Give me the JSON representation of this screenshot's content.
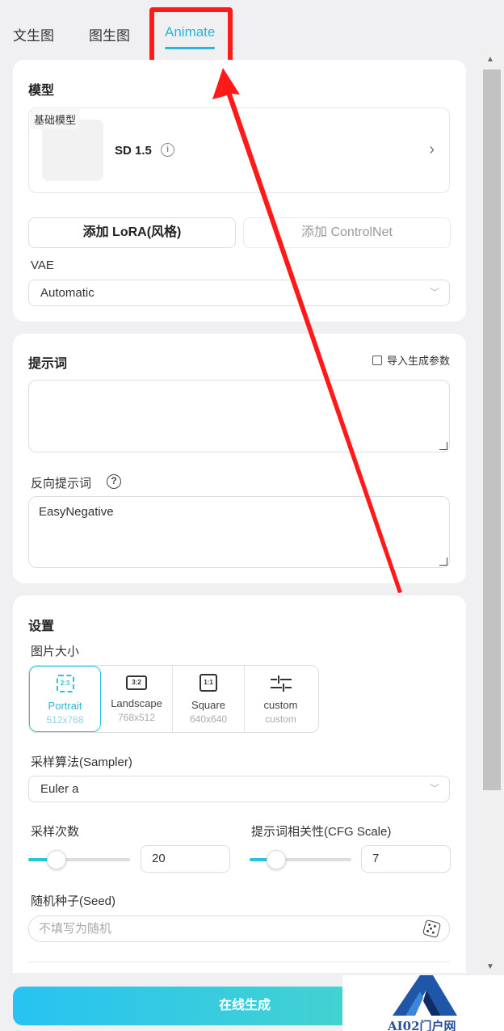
{
  "tabs": [
    {
      "label": "文生图"
    },
    {
      "label": "图生图"
    },
    {
      "label": "Animate"
    }
  ],
  "model": {
    "title": "模型",
    "tag": "基础模型",
    "name": "SD 1.5",
    "add_lora": "添加 LoRA(风格)",
    "add_controlnet": "添加 ControlNet",
    "vae_label": "VAE",
    "vae_value": "Automatic"
  },
  "prompt": {
    "title": "提示词",
    "import_label": "导入生成参数",
    "positive": "",
    "negative_label": "反向提示词",
    "negative": "EasyNegative"
  },
  "settings": {
    "title": "设置",
    "size_label": "图片大小",
    "sizes": [
      {
        "icon": "2:3",
        "name": "Portrait",
        "res": "512x768",
        "active": true
      },
      {
        "icon": "3:2",
        "name": "Landscape",
        "res": "768x512"
      },
      {
        "icon": "1:1",
        "name": "Square",
        "res": "640x640"
      },
      {
        "icon": "",
        "name": "custom",
        "res": "custom"
      }
    ],
    "sampler_label": "采样算法(Sampler)",
    "sampler_value": "Euler a",
    "steps_label": "采样次数",
    "steps_value": "20",
    "steps_fraction": 0.28,
    "cfg_label": "提示词相关性(CFG Scale)",
    "cfg_value": "7",
    "cfg_fraction": 0.26,
    "seed_label": "随机种子(Seed)",
    "seed_placeholder": "不填写为随机"
  },
  "generate_label": "在线生成",
  "watermark": "AI02门户网",
  "accent": "#29b6d8",
  "annotation_color": "#ff1a1a"
}
